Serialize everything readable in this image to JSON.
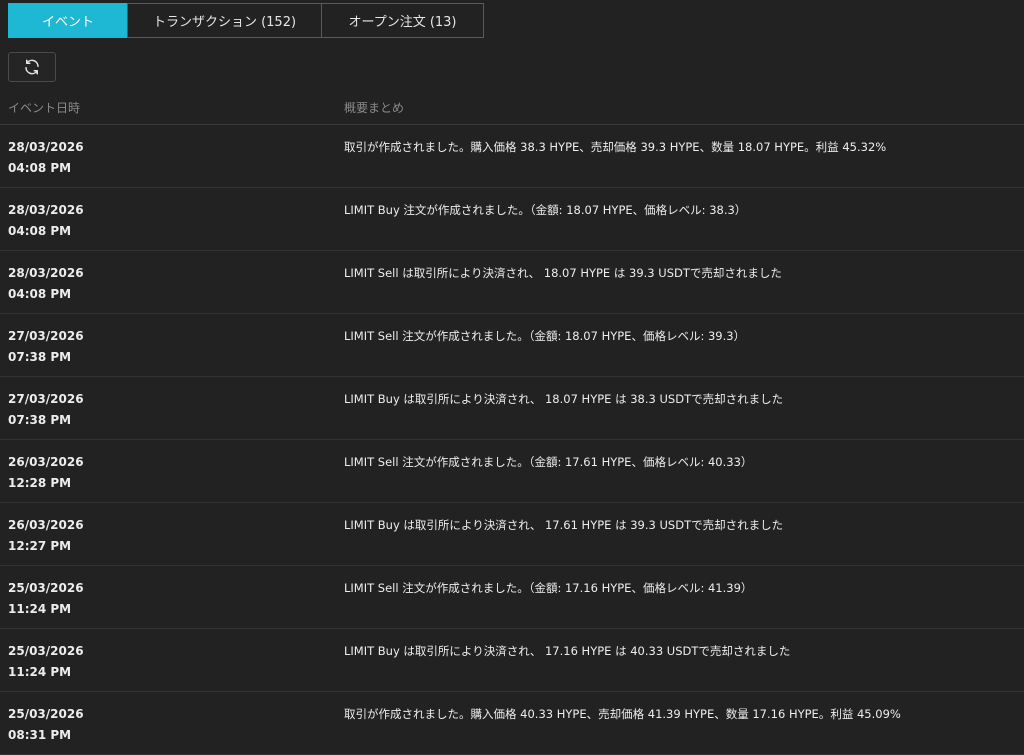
{
  "tabs": [
    {
      "label": "イベント",
      "active": true
    },
    {
      "label": "トランザクション (152)",
      "active": false
    },
    {
      "label": "オープン注文 (13)",
      "active": false
    }
  ],
  "refresh_icon": "refresh-icon",
  "table": {
    "headers": {
      "date": "イベント日時",
      "summary": "概要まとめ"
    },
    "rows": [
      {
        "date": "28/03/2026",
        "time": "04:08 PM",
        "summary": "取引が作成されました。購入価格 38.3 HYPE、売却価格 39.3 HYPE、数量 18.07 HYPE。利益 45.32%"
      },
      {
        "date": "28/03/2026",
        "time": "04:08 PM",
        "summary": "LIMIT Buy 注文が作成されました。（金額: 18.07 HYPE、価格レベル: 38.3）"
      },
      {
        "date": "28/03/2026",
        "time": "04:08 PM",
        "summary": "LIMIT Sell は取引所により決済され、 18.07 HYPE は 39.3 USDTで売却されました"
      },
      {
        "date": "27/03/2026",
        "time": "07:38 PM",
        "summary": "LIMIT Sell 注文が作成されました。（金額: 18.07 HYPE、価格レベル: 39.3）"
      },
      {
        "date": "27/03/2026",
        "time": "07:38 PM",
        "summary": "LIMIT Buy は取引所により決済され、 18.07 HYPE は 38.3 USDTで売却されました"
      },
      {
        "date": "26/03/2026",
        "time": "12:28 PM",
        "summary": "LIMIT Sell 注文が作成されました。（金額: 17.61 HYPE、価格レベル: 40.33）"
      },
      {
        "date": "26/03/2026",
        "time": "12:27 PM",
        "summary": "LIMIT Buy は取引所により決済され、 17.61 HYPE は 39.3 USDTで売却されました"
      },
      {
        "date": "25/03/2026",
        "time": "11:24 PM",
        "summary": "LIMIT Sell 注文が作成されました。（金額: 17.16 HYPE、価格レベル: 41.39）"
      },
      {
        "date": "25/03/2026",
        "time": "11:24 PM",
        "summary": "LIMIT Buy は取引所により決済され、 17.16 HYPE は 40.33 USDTで売却されました"
      },
      {
        "date": "25/03/2026",
        "time": "08:31 PM",
        "summary": "取引が作成されました。購入価格 40.33 HYPE、売却価格 41.39 HYPE、数量 17.16 HYPE。利益 45.09%"
      }
    ]
  },
  "colors": {
    "accent": "#1fb8d4",
    "background": "#222222",
    "divider": "#333333"
  }
}
